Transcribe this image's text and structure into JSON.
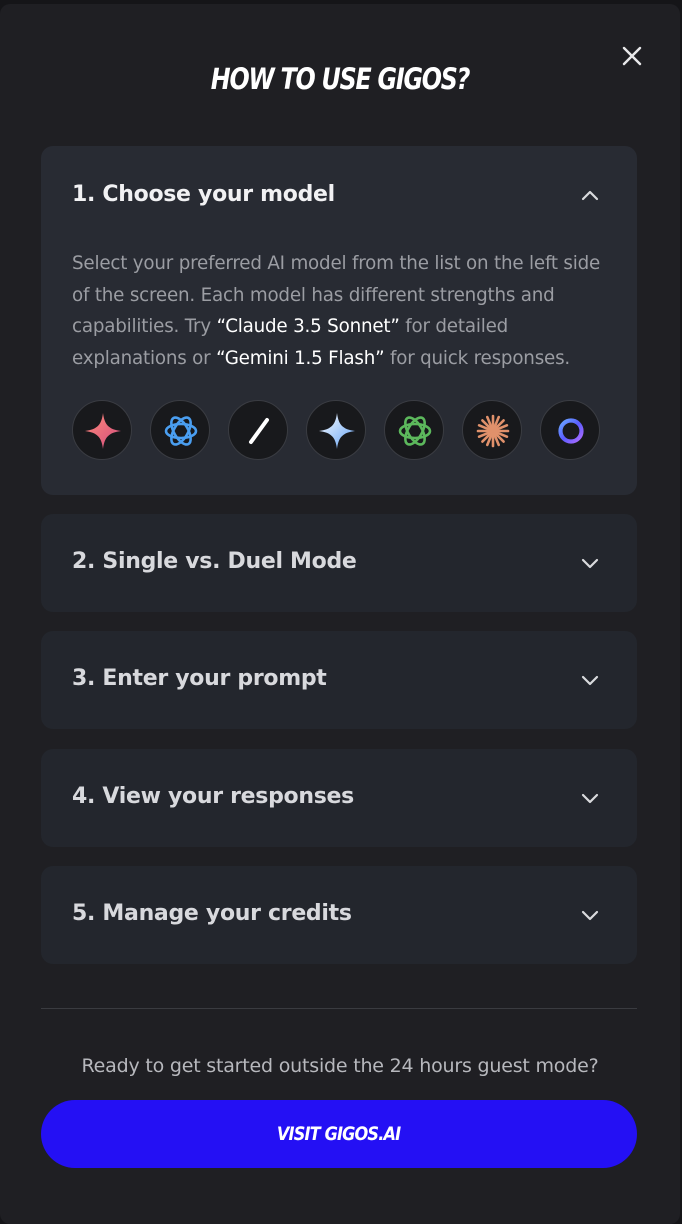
{
  "modal": {
    "title": "HOW TO USE GIGOS?",
    "close_icon": "close-icon"
  },
  "sections": [
    {
      "label": "1. Choose your model",
      "expanded": true,
      "body": {
        "part1": "Select your preferred AI model from the list on the left side of the screen. Each model has different strengths and capabilities. Try ",
        "highlight1": "“Claude 3.5 Sonnet”",
        "part2": " for detailed explanations or ",
        "highlight2": "“Gemini 1.5 Flash”",
        "part3": " for quick responses."
      },
      "model_icons": [
        "gemini-pink-sparkle-icon",
        "openai-blue-icon",
        "slash-icon",
        "gemini-blue-sparkle-icon",
        "openai-green-icon",
        "claude-starburst-icon",
        "ring-icon"
      ]
    },
    {
      "label": "2. Single vs. Duel Mode",
      "expanded": false
    },
    {
      "label": "3. Enter your prompt",
      "expanded": false
    },
    {
      "label": "4. View your responses",
      "expanded": false
    },
    {
      "label": "5. Manage your credits",
      "expanded": false
    }
  ],
  "footer": {
    "prompt": "Ready to get started outside the 24 hours guest mode?",
    "cta_label": "VISIT GIGOS.AI"
  },
  "colors": {
    "background": "#1f1f23",
    "panel": "#23262d",
    "cta": "#2410f4",
    "text": "#ffffff",
    "muted": "#9b9da3"
  }
}
